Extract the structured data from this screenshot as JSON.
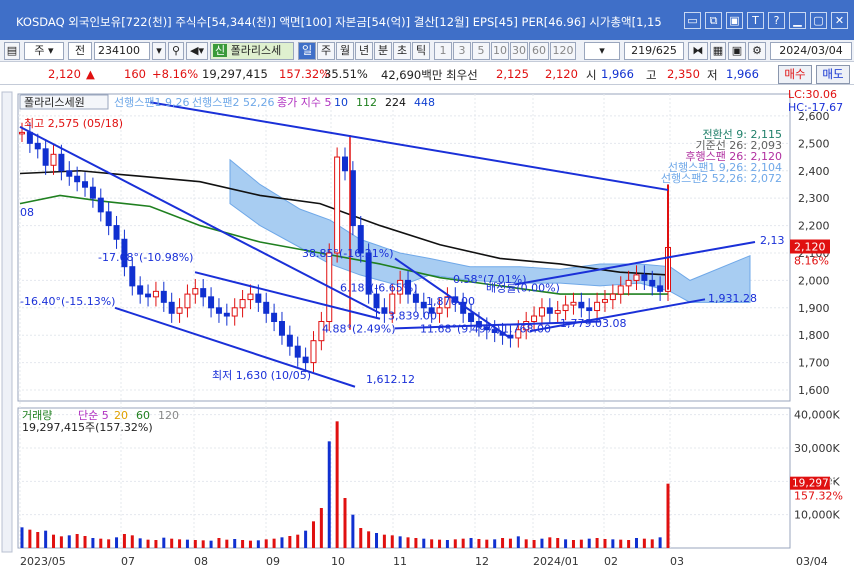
{
  "window": {
    "title": "KOSDAQ 외국인보유[722(천)] 주식수[54,344(천)] 액면[100] 자본금[54(억)] 결산[12월] EPS[45] PER[46.96] 시가총액[1,15",
    "buttons": [
      "▭",
      "⧉",
      "▣",
      "T",
      "?",
      "▁",
      "▢",
      "✕"
    ]
  },
  "toolbar": {
    "market": "주",
    "period_type": "전",
    "code": "234100",
    "stock_name": "폴라리스세",
    "intervals": [
      "일",
      "주",
      "월",
      "년",
      "분",
      "초",
      "틱"
    ],
    "numbers": [
      "1",
      "3",
      "5",
      "10",
      "30",
      "60",
      "120"
    ],
    "page_info": "219/625",
    "date": "2024/03/04"
  },
  "quote": {
    "price": "2,120",
    "arrow": "▲",
    "change": "160",
    "change_pct": "+8.16%",
    "volume": "19,297,415",
    "vol_ratio": "157.32%",
    "turnover": "35.51%",
    "amount": "42,690백만",
    "preferred_label": "최우선",
    "ask": "2,125",
    "bid": "2,120",
    "open_label": "시",
    "open": "1,966",
    "high_label": "고",
    "high": "2,350",
    "low_label": "저",
    "low": "1,966",
    "buy_button": "매수",
    "sell_button": "매도"
  },
  "chart_data": {
    "type": "candlestick",
    "stock": "폴라리스세원",
    "legend": [
      {
        "name": "선행스팬1",
        "value": "9,26",
        "color": "#6fa8e8"
      },
      {
        "name": "선행스팬2",
        "value": "52,26",
        "color": "#6fa8e8"
      },
      {
        "name": "종가 지수",
        "value": "5",
        "color": "#b030c0"
      },
      {
        "name": "10",
        "color": "#1040d0"
      },
      {
        "name": "112",
        "color": "#208020"
      },
      {
        "name": "224",
        "color": "#111111"
      },
      {
        "name": "448",
        "color": "#1040d0"
      }
    ],
    "ichimoku_values": [
      {
        "label": "전환선 9: 2,115",
        "color": "#20806a"
      },
      {
        "label": "기준선 26: 2,093",
        "color": "#606060"
      },
      {
        "label": "후행스팬 26: 2,120",
        "color": "#b030a0"
      },
      {
        "label": "선행스팬1 9,26: 2,104",
        "color": "#6fa8e8"
      },
      {
        "label": "선행스팬2 52,26: 2,072",
        "color": "#6fa8e8"
      }
    ],
    "corner": {
      "lc": "LC:30.06",
      "hc": "HC:-17.67"
    },
    "y_ticks": [
      "2,600",
      "2,500",
      "2,400",
      "2,300",
      "2,200",
      "2,100",
      "2,000",
      "1,900",
      "1,800",
      "1,700",
      "1,600"
    ],
    "ylim": [
      1560,
      2680
    ],
    "current_price": "2,120",
    "current_pct": "8.16%",
    "annotations": {
      "high": "최고 2,575 (05/18)",
      "low": "최저 1,630 (10/05)",
      "low_end": "1,612.12",
      "trend_1": "-17.68°(-10.98%)",
      "trend_2": "-16.40°(-15.13%)",
      "trend_3": "38.85°(-16.21%)",
      "trend_4": "0.58°(7.01%)",
      "trend_5": "4.88°(2.49%)",
      "trend_6": "11.68°(9.49%)",
      "channel_top": "2,13",
      "channel_low": "1,931.28",
      "p1768": "1,768.00",
      "p1779": "1,779.03.08",
      "left_08": "08",
      "m_label": "3,839.00",
      "chart_num": "1,876.00",
      "tl_a": "6.18°(-6.65%)",
      "tl_b": "배정률(0.00%)"
    },
    "x_ticks": [
      "2023/05",
      "07",
      "08",
      "09",
      "10",
      "11",
      "12",
      "2024/01",
      "02",
      "03",
      "03/04"
    ],
    "volume": {
      "legend": "거래량",
      "ma_labels": [
        {
          "name": "단순 5",
          "color": "#b030c0"
        },
        {
          "name": "20",
          "color": "#e0a000"
        },
        {
          "name": "60",
          "color": "#208020"
        },
        {
          "name": "120",
          "color": "#888888"
        }
      ],
      "current": "19,297,415주(157.32%)",
      "y_ticks": [
        "40,000K",
        "30,000K",
        "20,000K",
        "10,000K"
      ],
      "ylim": [
        0,
        42000
      ],
      "current_value": "19,297K",
      "current_pct": "157.32%"
    }
  }
}
